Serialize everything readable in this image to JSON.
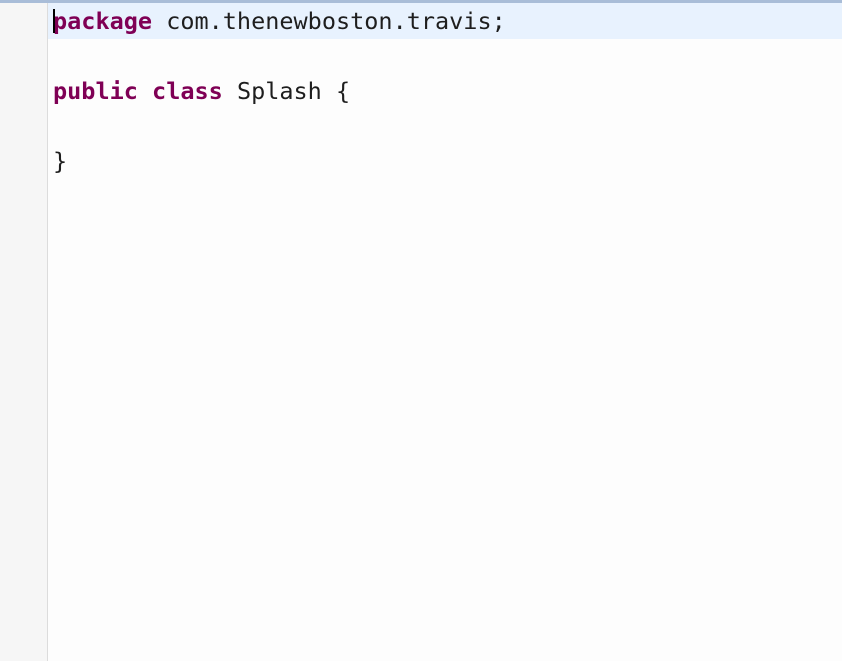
{
  "colors": {
    "keyword": "#7f0055",
    "text": "#1e1e1e",
    "current_line": "#e8f2fe",
    "gutter": "#f6f6f6"
  },
  "code": {
    "line1": {
      "keyword": "package",
      "rest": " com.thenewboston.travis;"
    },
    "line2": {
      "keyword1": "public",
      "keyword2": "class",
      "rest": " Splash {"
    },
    "line3": {
      "text": "}"
    }
  }
}
